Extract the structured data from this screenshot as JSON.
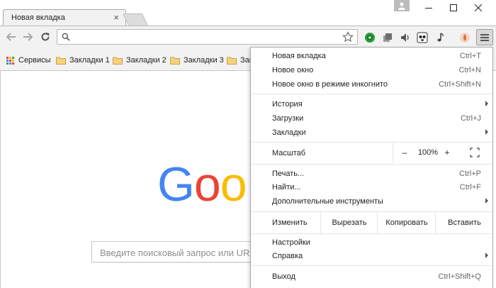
{
  "tab": {
    "title": "Новая вкладка",
    "close": "×"
  },
  "omnibox": {
    "value": ""
  },
  "bookmarks": [
    {
      "label": "Сервисы",
      "icon": "apps-grid-icon"
    },
    {
      "label": "Закладки 1",
      "icon": "folder-icon"
    },
    {
      "label": "Закладки 2",
      "icon": "folder-icon"
    },
    {
      "label": "Закладки 3",
      "icon": "folder-icon"
    },
    {
      "label": "Закл",
      "icon": "folder-icon"
    }
  ],
  "logo": {
    "text": "Goo",
    "colors": [
      "#4285F4",
      "#EA4335",
      "#FBBC05"
    ]
  },
  "search": {
    "placeholder": "Введите поисковый запрос или URL"
  },
  "menu": {
    "new_tab": {
      "label": "Новая вкладка",
      "shortcut": "Ctrl+T"
    },
    "new_window": {
      "label": "Новое окно",
      "shortcut": "Ctrl+N"
    },
    "incognito": {
      "label": "Новое окно в режиме инкогнито",
      "shortcut": "Ctrl+Shift+N"
    },
    "history": {
      "label": "История"
    },
    "downloads": {
      "label": "Загрузки",
      "shortcut": "Ctrl+J"
    },
    "bookmarks": {
      "label": "Закладки"
    },
    "zoom": {
      "label": "Масштаб",
      "minus": "–",
      "value": "100%",
      "plus": "+"
    },
    "print": {
      "label": "Печать...",
      "shortcut": "Ctrl+P"
    },
    "find": {
      "label": "Найти...",
      "shortcut": "Ctrl+F"
    },
    "more_tools": {
      "label": "Дополнительные инструменты"
    },
    "edit": {
      "label": "Изменить",
      "cut": "Вырезать",
      "copy": "Копировать",
      "paste": "Вставить"
    },
    "settings": {
      "label": "Настройки"
    },
    "help": {
      "label": "Справка"
    },
    "exit": {
      "label": "Выход",
      "shortcut": "Ctrl+Shift+Q"
    }
  }
}
